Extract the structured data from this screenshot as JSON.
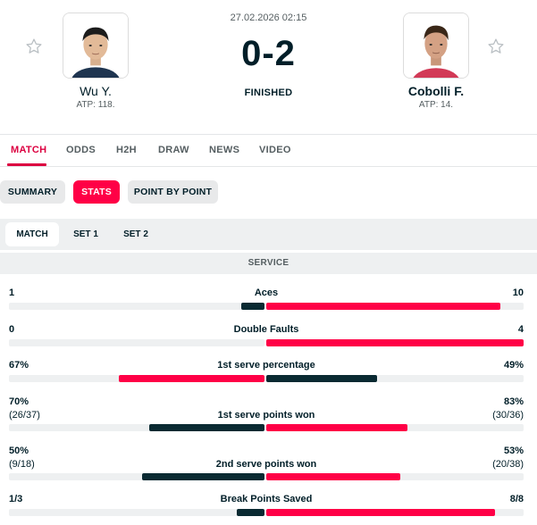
{
  "match": {
    "datetime": "27.02.2026 02:15",
    "score": "0-2",
    "status": "FINISHED"
  },
  "home": {
    "name": "Wu Y.",
    "rank": "ATP: 118.",
    "favorite_icon": "star-outline-icon"
  },
  "away": {
    "name": "Cobolli F.",
    "rank": "ATP: 14.",
    "favorite_icon": "star-outline-icon"
  },
  "tabs": [
    {
      "label": "MATCH",
      "active": true
    },
    {
      "label": "ODDS"
    },
    {
      "label": "H2H"
    },
    {
      "label": "DRAW"
    },
    {
      "label": "NEWS"
    },
    {
      "label": "VIDEO"
    }
  ],
  "subtabs": [
    {
      "label": "SUMMARY"
    },
    {
      "label": "STATS",
      "active": true
    },
    {
      "label": "POINT BY POINT"
    }
  ],
  "periods": [
    {
      "label": "MATCH",
      "active": true
    },
    {
      "label": "SET 1"
    },
    {
      "label": "SET 2"
    }
  ],
  "section_title": "SERVICE",
  "colors": {
    "accent": "#ff0046",
    "home_bar_dark": "#0a2a32",
    "away_bar": "#ff0046",
    "neutral": "#eef0f1"
  },
  "stats": [
    {
      "label": "Aces",
      "home": "1",
      "away": "10",
      "home_fill": 0.09,
      "away_fill": 0.91,
      "home_leads": false
    },
    {
      "label": "Double Faults",
      "home": "0",
      "away": "4",
      "home_fill": 0.0,
      "away_fill": 1.0,
      "home_leads": false
    },
    {
      "label": "1st serve percentage",
      "home": "67%",
      "away": "49%",
      "home_fill": 0.57,
      "away_fill": 0.43,
      "home_leads": true
    },
    {
      "label": "1st serve points won",
      "home": "70%",
      "home_sub": "(26/37)",
      "away": "83%",
      "away_sub": "(30/36)",
      "home_fill": 0.45,
      "away_fill": 0.55,
      "home_leads": false
    },
    {
      "label": "2nd serve points won",
      "home": "50%",
      "home_sub": "(9/18)",
      "away": "53%",
      "away_sub": "(20/38)",
      "home_fill": 0.48,
      "away_fill": 0.52,
      "home_leads": false
    },
    {
      "label": "Break Points Saved",
      "home": "1/3",
      "away": "8/8",
      "home_fill": 0.11,
      "away_fill": 0.89,
      "home_leads": false
    }
  ]
}
